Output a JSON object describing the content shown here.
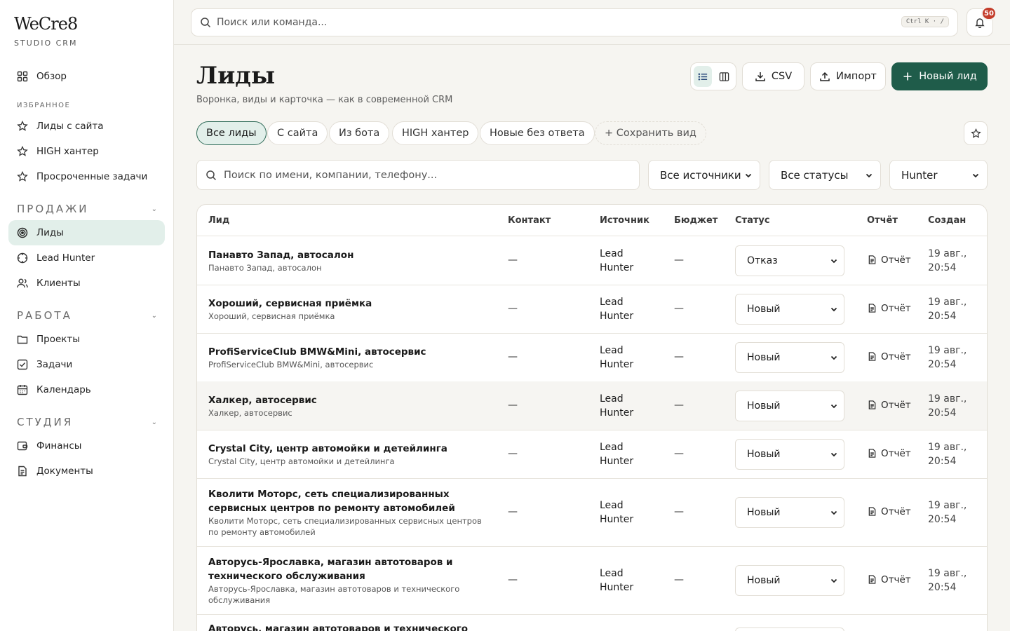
{
  "brand": {
    "name": "WeCre8",
    "subtitle": "STUDIO CRM"
  },
  "sidebar": {
    "overview": "Обзор",
    "favorites_label": "ИЗБРАННОЕ",
    "favorites": [
      "Лиды с сайта",
      "HIGH хантер",
      "Просроченные задачи"
    ],
    "sections": [
      {
        "title": "ПРОДАЖИ",
        "items": [
          "Лиды",
          "Lead Hunter",
          "Клиенты"
        ]
      },
      {
        "title": "РАБОТА",
        "items": [
          "Проекты",
          "Задачи",
          "Календарь"
        ]
      },
      {
        "title": "СТУДИЯ",
        "items": [
          "Финансы",
          "Документы"
        ]
      }
    ],
    "active_item": "Лиды"
  },
  "topbar": {
    "search_placeholder": "Поиск или команда...",
    "shortcut": "Ctrl K · /",
    "notifications_count": "50"
  },
  "page": {
    "title": "Лиды",
    "subtitle": "Воронка, виды и карточка — как в современной CRM",
    "csv_label": "CSV",
    "import_label": "Импорт",
    "new_lead_label": "Новый лид"
  },
  "views": {
    "chips": [
      "Все лиды",
      "С сайта",
      "Из бота",
      "HIGH хантер",
      "Новые без ответа"
    ],
    "save_view": "+ Сохранить вид",
    "active": "Все лиды"
  },
  "filters": {
    "search_placeholder": "Поиск по имени, компании, телефону...",
    "source": "Все источники",
    "status": "Все статусы",
    "owner": "Hunter"
  },
  "table": {
    "headers": {
      "lead": "Лид",
      "contact": "Контакт",
      "source": "Источник",
      "budget": "Бюджет",
      "status": "Статус",
      "report": "Отчёт",
      "created": "Создан"
    },
    "rows": [
      {
        "name": "Панавто Запад, автосалон",
        "sub": "Панавто Запад, автосалон",
        "contact": "—",
        "source1": "Lead",
        "source2": "Hunter",
        "budget": "—",
        "status": "Отказ",
        "report": "Отчёт",
        "created1": "19 авг.,",
        "created2": "20:54"
      },
      {
        "name": "Хороший, сервисная приёмка",
        "sub": "Хороший, сервисная приёмка",
        "contact": "—",
        "source1": "Lead",
        "source2": "Hunter",
        "budget": "—",
        "status": "Новый",
        "report": "Отчёт",
        "created1": "19 авг.,",
        "created2": "20:54"
      },
      {
        "name": "ProfiServiceClub BMW&Mini, автосервис",
        "sub": "ProfiServiceClub BMW&Mini, автосервис",
        "contact": "—",
        "source1": "Lead",
        "source2": "Hunter",
        "budget": "—",
        "status": "Новый",
        "report": "Отчёт",
        "created1": "19 авг.,",
        "created2": "20:54"
      },
      {
        "name": "Халкер, автосервис",
        "sub": "Халкер, автосервис",
        "contact": "—",
        "source1": "Lead",
        "source2": "Hunter",
        "budget": "—",
        "status": "Новый",
        "report": "Отчёт",
        "created1": "19 авг.,",
        "created2": "20:54"
      },
      {
        "name": "Crystal City, центр автомойки и детейлинга",
        "sub": "Crystal City, центр автомойки и детейлинга",
        "contact": "—",
        "source1": "Lead",
        "source2": "Hunter",
        "budget": "—",
        "status": "Новый",
        "report": "Отчёт",
        "created1": "19 авг.,",
        "created2": "20:54"
      },
      {
        "name": "Кволити Моторс, сеть специализированных сервисных центров по ремонту автомобилей",
        "sub": "Кволити Моторс, сеть специализированных сервисных центров по ремонту автомобилей",
        "contact": "—",
        "source1": "Lead",
        "source2": "Hunter",
        "budget": "—",
        "status": "Новый",
        "report": "Отчёт",
        "created1": "19 авг.,",
        "created2": "20:54"
      },
      {
        "name": "Авторусь-Ярославка, магазин автотоваров и технического обслуживания",
        "sub": "Авторусь-Ярославка, магазин автотоваров и технического обслуживания",
        "contact": "—",
        "source1": "Lead",
        "source2": "Hunter",
        "budget": "—",
        "status": "Новый",
        "report": "Отчёт",
        "created1": "19 авг.,",
        "created2": "20:54"
      },
      {
        "name": "Авторусь, магазин автотоваров и технического",
        "sub": "",
        "contact": "",
        "source1": "",
        "source2": "",
        "budget": "",
        "status": "",
        "report": "",
        "created1": "",
        "created2": ""
      }
    ]
  },
  "colors": {
    "accent": "#1f5c4a",
    "active_bg": "#e2efea",
    "badge": "#c43d2b"
  }
}
